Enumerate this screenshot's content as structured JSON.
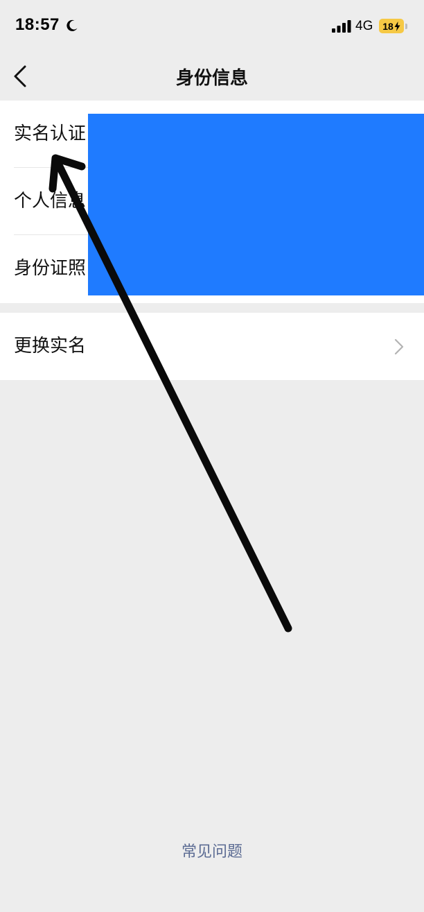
{
  "status_bar": {
    "time": "18:57",
    "network": "4G",
    "battery": "18",
    "icons": [
      "moon-icon",
      "signal-icon",
      "charging-icon"
    ]
  },
  "nav": {
    "title": "身份信息",
    "back_icon": "chevron-left-icon"
  },
  "identity_group": {
    "items": [
      {
        "label": "实名认证"
      },
      {
        "label": "个人信息"
      },
      {
        "label": "身份证照"
      }
    ]
  },
  "change_group": {
    "label": "更换实名",
    "icon": "chevron-right-icon"
  },
  "footer": {
    "faq_label": "常见问题"
  },
  "colors": {
    "background": "#ededed",
    "card": "#ffffff",
    "redaction": "#1f7bff",
    "link": "#5b6b93",
    "battery": "#f6c945"
  }
}
